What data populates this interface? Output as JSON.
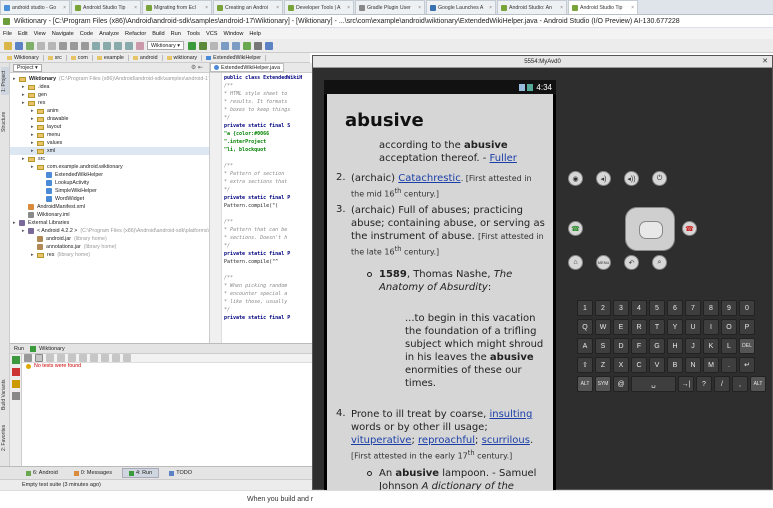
{
  "browser_tabs": [
    {
      "label": "android studio - Go",
      "color": "#4a8fd9"
    },
    {
      "label": "Android Studio Tip",
      "color": "#7aa43a"
    },
    {
      "label": "Migrating from Ecl",
      "color": "#7aa43a"
    },
    {
      "label": "Creating an Androi",
      "color": "#7aa43a"
    },
    {
      "label": "Developer Tools | A",
      "color": "#7aa43a"
    },
    {
      "label": "Gradle Plugin User",
      "color": "#888"
    },
    {
      "label": "Google Launches A",
      "color": "#3a6fb0"
    },
    {
      "label": "Android Studio: An",
      "color": "#7aa43a"
    },
    {
      "label": "Android Studio Tip",
      "color": "#7aa43a"
    }
  ],
  "window_title": "Wiktionary - [C:\\Program Files (x86)\\Android\\android-sdk\\samples\\android-17\\Wiktionary] - [Wiktionary] - ...\\src\\com\\example\\android\\wiktionary\\ExtendedWikiHelper.java - Android Studio (I/O Preview) AI-130.677228",
  "menu": [
    "File",
    "Edit",
    "View",
    "Navigate",
    "Code",
    "Analyze",
    "Refactor",
    "Build",
    "Run",
    "Tools",
    "VCS",
    "Window",
    "Help"
  ],
  "toolbar": {
    "run_config": "Wiktionary"
  },
  "nav_crumbs": [
    "Wiktionary",
    "src",
    "com",
    "example",
    "android",
    "wiktionary",
    "ExtendedWikiHelper"
  ],
  "project": {
    "selector": "Project",
    "tree": [
      {
        "text": "Wiktionary",
        "extra": "(C:\\Program Files (x86)\\Android\\android-sdk\\samples\\android-17\\Wiktionary)",
        "level": 0,
        "icon": "folder",
        "bold": true
      },
      {
        "text": ".idea",
        "extra": "",
        "level": 1,
        "icon": "folder"
      },
      {
        "text": "gen",
        "extra": "",
        "level": 1,
        "icon": "folder"
      },
      {
        "text": "res",
        "extra": "",
        "level": 1,
        "icon": "folder"
      },
      {
        "text": "anim",
        "extra": "",
        "level": 2,
        "icon": "folder"
      },
      {
        "text": "drawable",
        "extra": "",
        "level": 2,
        "icon": "folder"
      },
      {
        "text": "layout",
        "extra": "",
        "level": 2,
        "icon": "folder"
      },
      {
        "text": "menu",
        "extra": "",
        "level": 2,
        "icon": "folder"
      },
      {
        "text": "values",
        "extra": "",
        "level": 2,
        "icon": "folder"
      },
      {
        "text": "xml",
        "extra": "",
        "level": 2,
        "icon": "folder",
        "selected": true
      },
      {
        "text": "src",
        "extra": "",
        "level": 1,
        "icon": "folder"
      },
      {
        "text": "com.example.android.wiktionary",
        "extra": "",
        "level": 2,
        "icon": "folder"
      },
      {
        "text": "ExtendedWikiHelper",
        "extra": "",
        "level": 3,
        "icon": "class"
      },
      {
        "text": "LookupActivity",
        "extra": "",
        "level": 3,
        "icon": "class"
      },
      {
        "text": "SimpleWikiHelper",
        "extra": "",
        "level": 3,
        "icon": "class"
      },
      {
        "text": "WordWidget",
        "extra": "",
        "level": 3,
        "icon": "class"
      },
      {
        "text": "AndroidManifest.xml",
        "extra": "",
        "level": 1,
        "icon": "xml"
      },
      {
        "text": "Wiktionary.iml",
        "extra": "",
        "level": 1,
        "icon": "iml"
      },
      {
        "text": "External Libraries",
        "extra": "",
        "level": 0,
        "icon": "lib"
      },
      {
        "text": "< Android 4.2.2 >",
        "extra": "(C:\\Program Files (x86)\\Android\\android-sdk\\platforms\\andr",
        "level": 1,
        "icon": "lib"
      },
      {
        "text": "android.jar",
        "extra": "(library home)",
        "level": 2,
        "icon": "jar"
      },
      {
        "text": "annotations.jar",
        "extra": "(library home)",
        "level": 2,
        "icon": "jar"
      },
      {
        "text": "res",
        "extra": "(library home)",
        "level": 2,
        "icon": "folder"
      }
    ]
  },
  "editor": {
    "tab": "ExtendedWikiHelper.java",
    "lines": [
      {
        "t": "public class ExtendedWikiH",
        "c": "kw"
      },
      {
        "t": "  /**",
        "c": "cm"
      },
      {
        "t": "   * HTML style sheet to",
        "c": "cm"
      },
      {
        "t": "   * results. It formats",
        "c": "cm"
      },
      {
        "t": "   * boxes to keep things",
        "c": "cm"
      },
      {
        "t": "   */",
        "c": "cm"
      },
      {
        "t": "  private static final S",
        "c": "kw"
      },
      {
        "t": "       \"a {color:#0066",
        "c": "st"
      },
      {
        "t": "       \".interProject",
        "c": "st"
      },
      {
        "t": "       \"li, blockquot",
        "c": "st"
      },
      {
        "t": "",
        "c": ""
      },
      {
        "t": "  /**",
        "c": "cm"
      },
      {
        "t": "   * Pattern of section",
        "c": "cm"
      },
      {
        "t": "   * extra sections that",
        "c": "cm"
      },
      {
        "t": "   */",
        "c": "cm"
      },
      {
        "t": "  private static final P",
        "c": "kw"
      },
      {
        "t": "       Pattern.compile(\"(",
        "c": ""
      },
      {
        "t": "",
        "c": ""
      },
      {
        "t": "  /**",
        "c": "cm"
      },
      {
        "t": "   * Pattern that can be",
        "c": "cm"
      },
      {
        "t": "   * sections. Doesn't h",
        "c": "cm"
      },
      {
        "t": "   */",
        "c": "cm"
      },
      {
        "t": "  private static final P",
        "c": "kw"
      },
      {
        "t": "       Pattern.compile(\"^",
        "c": ""
      },
      {
        "t": "",
        "c": ""
      },
      {
        "t": "  /**",
        "c": "cm"
      },
      {
        "t": "   * When picking random",
        "c": "cm"
      },
      {
        "t": "   * encounter special a",
        "c": "cm"
      },
      {
        "t": "   * like those, usually",
        "c": "cm"
      },
      {
        "t": "   */",
        "c": "cm"
      },
      {
        "t": "  private static final P",
        "c": "kw"
      }
    ]
  },
  "run": {
    "title": "Run",
    "config": "Wiktionary",
    "message": "No tests were found"
  },
  "side_tabs": {
    "project": "1: Project",
    "structure": "Structure",
    "build_variants": "Build Variants",
    "favorites": "2: Favorites"
  },
  "bottom_tabs": [
    "6: Android",
    "0: Messages",
    "4: Run",
    "TODO"
  ],
  "status": "Empty test suite (3 minutes ago)",
  "web_footer": "When you build and r",
  "emulator": {
    "title": "5554:MyAvd0",
    "clock": "4:34",
    "word": "abusive",
    "def1_tail": [
      {
        "text": "according to the "
      },
      {
        "text": "abusive",
        "bold": true
      },
      {
        "text": "acceptation thereof. - "
      },
      {
        "text": "Fuller",
        "link": true
      }
    ],
    "def2": {
      "num": "2.",
      "pre": "(archaic) ",
      "link": "Catachrestic",
      "post": ". [First attested in",
      "line2": "the mid 16",
      "sup": "th",
      "line2b": " century.]"
    },
    "def3": {
      "num": "3.",
      "lines": [
        "(archaic) Full of abuses; practicing",
        "abuse; containing abuse, or serving as",
        "the instrument of abuse."
      ],
      "attest_a": "[First attested in",
      "attest_b": "the late 16",
      "sup": "th",
      "attest_c": " century.]"
    },
    "quote": {
      "year": "1589",
      "author": ", Thomas Nashe, ",
      "work1": "The",
      "work2": "Anatomy of Absurdity",
      "colon": ":",
      "lines": [
        "...to begin in this vacation",
        "the foundation of a trifling",
        "subject which might shroud",
        "in his leaves the ",
        "enormities of these our",
        "times."
      ],
      "bold": "abusive"
    },
    "def4": {
      "num": "4.",
      "line1_pre": "Prone to ill treat by coarse, ",
      "line1_link": "insulting",
      "line2": "words or by other ill usage;",
      "link_a": "vituperative",
      "link_b": "reproachful",
      "link_c": "scurrilous",
      "sep": "; ",
      "end": ".",
      "attest": "[First attested in the early 17",
      "sup": "th",
      "attest_end": " century.]"
    },
    "lampoon": {
      "pre": "An ",
      "bold": "abusive",
      "post": " lampoon. - Samuel",
      "line2": "Johnson ",
      "line2i": "A dictionary of the"
    },
    "keyboard": {
      "row1": [
        "1",
        "2",
        "3",
        "4",
        "5",
        "6",
        "7",
        "8",
        "9",
        "0"
      ],
      "row2": [
        "Q",
        "W",
        "E",
        "R",
        "T",
        "Y",
        "U",
        "I",
        "O",
        "P"
      ],
      "row3": [
        "A",
        "S",
        "D",
        "F",
        "G",
        "H",
        "J",
        "K",
        "L",
        "DEL"
      ],
      "row4": [
        "⇧",
        "Z",
        "X",
        "C",
        "V",
        "B",
        "N",
        "M",
        ".",
        "↵"
      ],
      "row5": [
        "ALT",
        "SYM",
        "@",
        "␣",
        "→|",
        "?",
        "/",
        ",",
        "ALT"
      ]
    }
  }
}
